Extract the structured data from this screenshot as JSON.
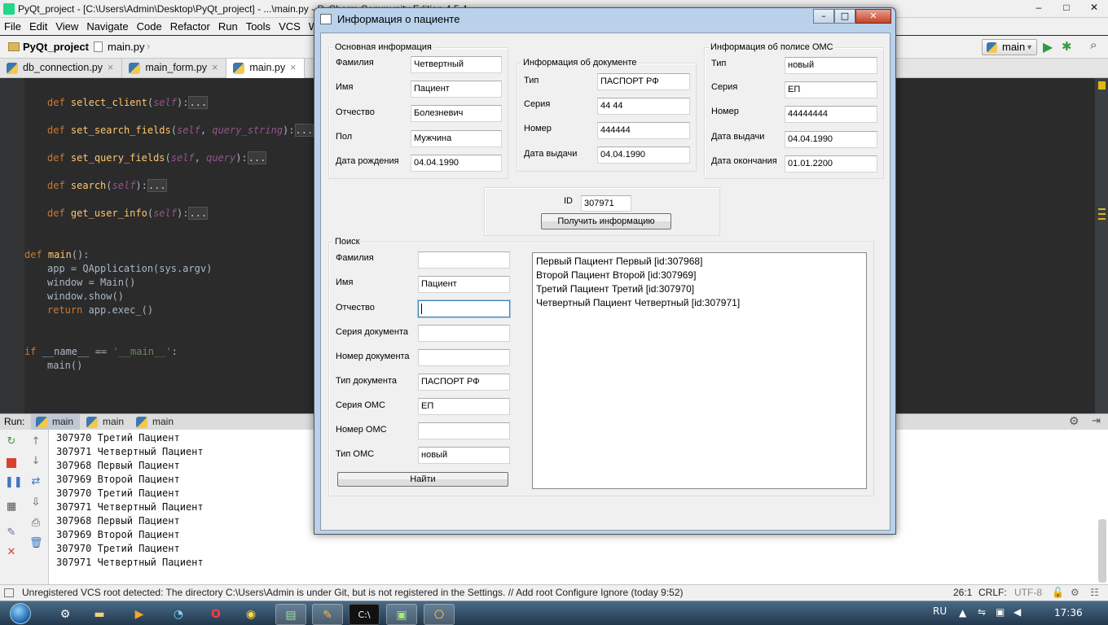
{
  "ide": {
    "title": "PyQt_project - [C:\\Users\\Admin\\Desktop\\PyQt_project] - ...\\main.py - PyCharm Community Edition 4.5.4",
    "window_controls": [
      "–",
      "□",
      "✕"
    ],
    "menu": [
      "File",
      "Edit",
      "View",
      "Navigate",
      "Code",
      "Refactor",
      "Run",
      "Tools",
      "VCS",
      "Wi"
    ],
    "breadcrumb": [
      "PyQt_project",
      "main.py"
    ],
    "run_config": "main",
    "tabs": [
      {
        "label": "db_connection.py",
        "close": "×"
      },
      {
        "label": "main_form.py",
        "close": "×"
      },
      {
        "label": "main.py",
        "close": "×"
      }
    ],
    "code": {
      "def": "def",
      "self": "self",
      "fold": "...",
      "m1": "select_client",
      "m2": "set_search_fields",
      "m2_arg": "query_string",
      "m3": "set_query_fields",
      "m3_arg": "query",
      "m4": "search",
      "m5": "get_user_info",
      "main_name": "main",
      "line_app": "app = QApplication(sys.argv)",
      "line_window": "window = Main()",
      "line_show": "window.show()",
      "ret": "return",
      "line_exec": " app.exec_()",
      "if_kw": "if",
      "name_var": " __name__ == ",
      "main_str": "'__main__'",
      "main_call": "main()"
    },
    "run_label": "Run:",
    "run_tabs": [
      "main",
      "main",
      "main"
    ],
    "console_lines": [
      "307970 Третий Пациент",
      "307971 Четвертный Пациент",
      "307968 Первый Пациент",
      "307969 Второй Пациент",
      "307970 Третий Пациент",
      "307971 Четвертный Пациент",
      "307968 Первый Пациент",
      "307969 Второй Пациент",
      "307970 Третий Пациент",
      "307971 Четвертный Пациент"
    ],
    "status": {
      "message": "Unregistered VCS root detected: The directory C:\\Users\\Admin is under Git, but is not registered in the Settings. // Add root  Configure  Ignore (today 9:52)",
      "position": "26:1",
      "line_sep": "CRLF:",
      "encoding": "UTF-8"
    }
  },
  "taskbar": {
    "lang": "RU",
    "time": "17:36"
  },
  "dialog": {
    "title": "Информация о пациенте",
    "basic": {
      "title": "Основная информация",
      "fields": [
        {
          "label": "Фамилия",
          "value": "Четвертный"
        },
        {
          "label": "Имя",
          "value": "Пациент"
        },
        {
          "label": "Отчество",
          "value": "Болезневич"
        },
        {
          "label": "Пол",
          "value": "Мужчина"
        },
        {
          "label": "Дата рождения",
          "value": "04.04.1990"
        }
      ]
    },
    "document": {
      "title": "Информация об документе",
      "fields": [
        {
          "label": "Тип",
          "value": "ПАСПОРТ РФ"
        },
        {
          "label": "Серия",
          "value": "44 44"
        },
        {
          "label": "Номер",
          "value": "444444"
        },
        {
          "label": "Дата выдачи",
          "value": "04.04.1990"
        }
      ]
    },
    "policy": {
      "title": "Информация об полисе ОМС",
      "fields": [
        {
          "label": "Тип",
          "value": "новый"
        },
        {
          "label": "Серия",
          "value": "ЕП"
        },
        {
          "label": "Номер",
          "value": "44444444"
        },
        {
          "label": "Дата выдачи",
          "value": "04.04.1990"
        },
        {
          "label": "Дата окончания",
          "value": "01.01.2200"
        }
      ]
    },
    "id_box": {
      "label": "ID",
      "value": "307971",
      "button": "Получить информацию"
    },
    "search": {
      "title": "Поиск",
      "fields": [
        {
          "label": "Фамилия",
          "value": ""
        },
        {
          "label": "Имя",
          "value": "Пациент"
        },
        {
          "label": "Отчество",
          "value": ""
        },
        {
          "label": "Серия документа",
          "value": ""
        },
        {
          "label": "Номер документа",
          "value": ""
        },
        {
          "label": "Тип документа",
          "value": "ПАСПОРТ РФ"
        },
        {
          "label": "Серия ОМС",
          "value": "ЕП"
        },
        {
          "label": "Номер ОМС",
          "value": ""
        },
        {
          "label": "Тип ОМС",
          "value": "новый"
        }
      ],
      "button": "Найти",
      "results": [
        "Первый Пациент Первый [id:307968]",
        "Второй Пациент Второй [id:307969]",
        "Третий Пациент Третий [id:307970]",
        "Четвертный Пациент Четвертный [id:307971]"
      ]
    }
  }
}
